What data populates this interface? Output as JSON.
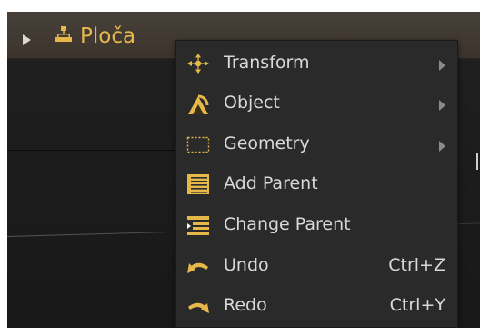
{
  "header": {
    "title": "Ploča",
    "accent_color": "#e6b84a",
    "expand_icon": "triangle-right-icon",
    "object_icon": "hierarchy-icon"
  },
  "context_menu": {
    "items": [
      {
        "label": "Transform",
        "icon": "move-arrows-icon",
        "has_submenu": true,
        "shortcut": ""
      },
      {
        "label": "Object",
        "icon": "object-icon",
        "has_submenu": true,
        "shortcut": ""
      },
      {
        "label": "Geometry",
        "icon": "dotted-rectangle-icon",
        "has_submenu": true,
        "shortcut": ""
      },
      {
        "label": "Add Parent",
        "icon": "add-parent-icon",
        "has_submenu": false,
        "shortcut": ""
      },
      {
        "label": "Change Parent",
        "icon": "change-parent-icon",
        "has_submenu": false,
        "shortcut": ""
      },
      {
        "label": "Undo",
        "icon": "undo-icon",
        "has_submenu": false,
        "shortcut": "Ctrl+Z"
      },
      {
        "label": "Redo",
        "icon": "redo-icon",
        "has_submenu": false,
        "shortcut": "Ctrl+Y"
      }
    ]
  }
}
